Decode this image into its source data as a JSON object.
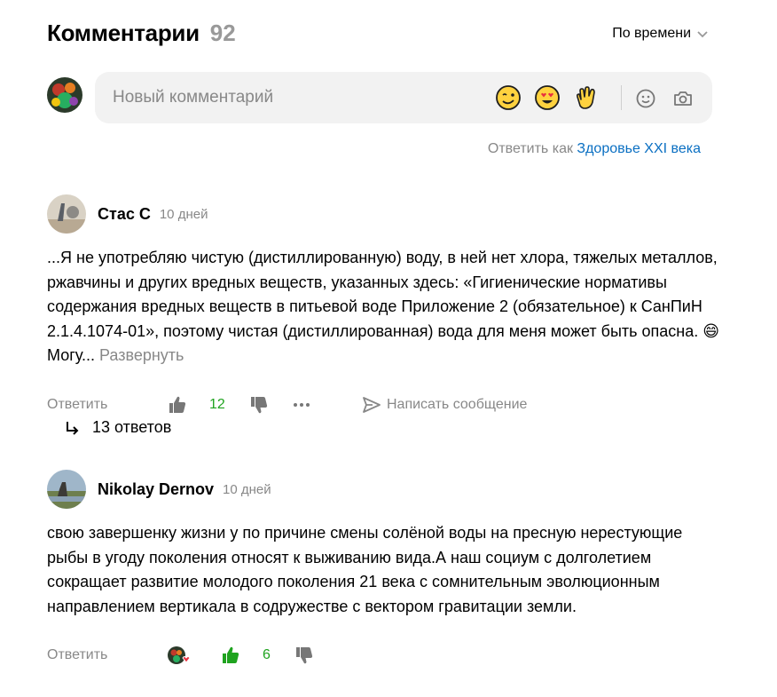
{
  "header": {
    "title": "Комментарии",
    "count": "92",
    "sort_label": "По времени"
  },
  "composer": {
    "placeholder": "Новый комментарий"
  },
  "reply_as": {
    "prefix": "Ответить как",
    "account": "Здоровье XXI века"
  },
  "comments": [
    {
      "author": "Стас С",
      "time": "10 дней",
      "text": "...Я не употребляю чистую (дистиллированную) воду, в ней нет хлора, тяжелых металлов, ржавчины и других вредных веществ, указанных здесь: «Гигиенические нормативы содержания вредных веществ в питьевой воде Приложение 2 (обязательное) к СанПиН 2.1.4.1074-01», поэтому чистая (дистиллированная) вода для меня может быть опасна. 😄 Могу...",
      "expand": "Развернуть",
      "reply_label": "Ответить",
      "likes": "12",
      "message_label": "Написать сообщение",
      "replies_label": "13 ответов"
    },
    {
      "author": "Nikolay Dernov",
      "time": "10 дней",
      "text": "свою завершенку жизни у по причине смены солёной воды на пресную нерестующие рыбы в угоду поколения относят к выживанию вида.А наш социум с долголетием сокращает развитие молодого поколения 21 века с сомнительным эволюционным направлением вертикала в содружестве с вектором гравитации земли.",
      "reply_label": "Ответить",
      "likes": "6"
    }
  ],
  "colors": {
    "like_green": "#1fa31f",
    "link_blue": "#0a6fc2",
    "muted": "#888888",
    "composer_bg": "#f2f2f2"
  }
}
